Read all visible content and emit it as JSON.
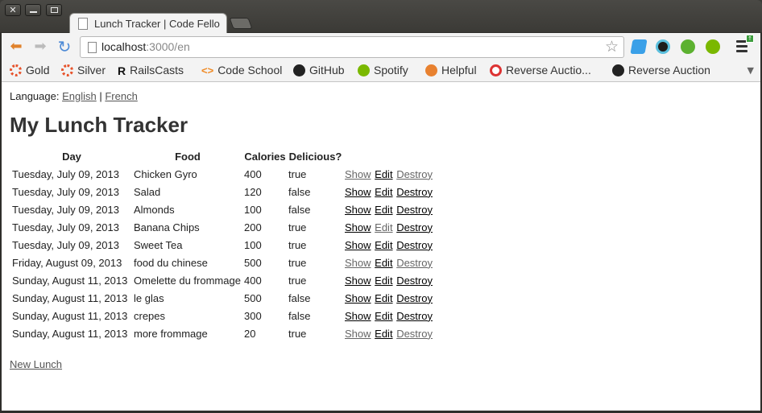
{
  "browser": {
    "tab_title": "Lunch Tracker | Code Fello",
    "url_host": "localhost",
    "url_path": ":3000/en",
    "bookmarks": [
      {
        "label": "Gold",
        "icon": "gold-icon"
      },
      {
        "label": "Silver",
        "icon": "silver-icon"
      },
      {
        "label": "RailsCasts",
        "icon": "railscasts-icon"
      },
      {
        "label": "Code School",
        "icon": "codeschool-icon"
      },
      {
        "label": "GitHub",
        "icon": "github-icon"
      },
      {
        "label": "Spotify",
        "icon": "spotify-icon"
      },
      {
        "label": "Helpful",
        "icon": "folder-icon"
      },
      {
        "label": "Reverse Auctio...",
        "icon": "reverse-auction-icon"
      },
      {
        "label": "Reverse Auction",
        "icon": "github-icon"
      }
    ]
  },
  "page": {
    "language_label": "Language:",
    "lang_en": "English",
    "lang_sep": "|",
    "lang_fr": "French",
    "title": "My Lunch Tracker",
    "columns": [
      "Day",
      "Food",
      "Calories",
      "Delicious?"
    ],
    "actions": {
      "show": "Show",
      "edit": "Edit",
      "destroy": "Destroy"
    },
    "rows": [
      {
        "day": "Tuesday, July 09, 2013",
        "food": "Chicken Gyro",
        "calories": "400",
        "delicious": "true"
      },
      {
        "day": "Tuesday, July 09, 2013",
        "food": "Salad",
        "calories": "120",
        "delicious": "false"
      },
      {
        "day": "Tuesday, July 09, 2013",
        "food": "Almonds",
        "calories": "100",
        "delicious": "false"
      },
      {
        "day": "Tuesday, July 09, 2013",
        "food": "Banana Chips",
        "calories": "200",
        "delicious": "true"
      },
      {
        "day": "Tuesday, July 09, 2013",
        "food": "Sweet Tea",
        "calories": "100",
        "delicious": "true"
      },
      {
        "day": "Friday, August 09, 2013",
        "food": "food du chinese",
        "calories": "500",
        "delicious": "true"
      },
      {
        "day": "Sunday, August 11, 2013",
        "food": "Omelette du frommage",
        "calories": "400",
        "delicious": "true"
      },
      {
        "day": "Sunday, August 11, 2013",
        "food": "le glas",
        "calories": "500",
        "delicious": "false"
      },
      {
        "day": "Sunday, August 11, 2013",
        "food": "crepes",
        "calories": "300",
        "delicious": "false"
      },
      {
        "day": "Sunday, August 11, 2013",
        "food": "more frommage",
        "calories": "20",
        "delicious": "true"
      }
    ],
    "new_lunch": "New Lunch"
  }
}
